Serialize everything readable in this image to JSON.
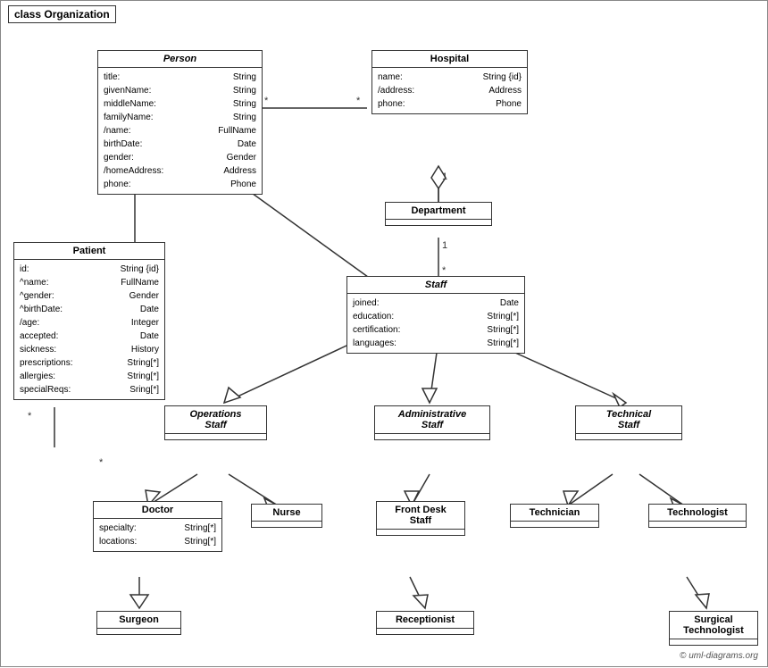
{
  "title": "class Organization",
  "classes": {
    "person": {
      "name": "Person",
      "italic": true,
      "attrs": [
        {
          "name": "title:",
          "type": "String"
        },
        {
          "name": "givenName:",
          "type": "String"
        },
        {
          "name": "middleName:",
          "type": "String"
        },
        {
          "name": "familyName:",
          "type": "String"
        },
        {
          "name": "/name:",
          "type": "FullName"
        },
        {
          "name": "birthDate:",
          "type": "Date"
        },
        {
          "name": "gender:",
          "type": "Gender"
        },
        {
          "name": "/homeAddress:",
          "type": "Address"
        },
        {
          "name": "phone:",
          "type": "Phone"
        }
      ]
    },
    "hospital": {
      "name": "Hospital",
      "italic": false,
      "attrs": [
        {
          "name": "name:",
          "type": "String {id}"
        },
        {
          "name": "/address:",
          "type": "Address"
        },
        {
          "name": "phone:",
          "type": "Phone"
        }
      ]
    },
    "patient": {
      "name": "Patient",
      "italic": false,
      "attrs": [
        {
          "name": "id:",
          "type": "String {id}"
        },
        {
          "name": "^name:",
          "type": "FullName"
        },
        {
          "name": "^gender:",
          "type": "Gender"
        },
        {
          "name": "^birthDate:",
          "type": "Date"
        },
        {
          "name": "/age:",
          "type": "Integer"
        },
        {
          "name": "accepted:",
          "type": "Date"
        },
        {
          "name": "sickness:",
          "type": "History"
        },
        {
          "name": "prescriptions:",
          "type": "String[*]"
        },
        {
          "name": "allergies:",
          "type": "String[*]"
        },
        {
          "name": "specialReqs:",
          "type": "Sring[*]"
        }
      ]
    },
    "department": {
      "name": "Department",
      "italic": false,
      "attrs": []
    },
    "staff": {
      "name": "Staff",
      "italic": true,
      "attrs": [
        {
          "name": "joined:",
          "type": "Date"
        },
        {
          "name": "education:",
          "type": "String[*]"
        },
        {
          "name": "certification:",
          "type": "String[*]"
        },
        {
          "name": "languages:",
          "type": "String[*]"
        }
      ]
    },
    "operations_staff": {
      "name": "Operations\nStaff",
      "italic": true,
      "attrs": []
    },
    "administrative_staff": {
      "name": "Administrative\nStaff",
      "italic": true,
      "attrs": []
    },
    "technical_staff": {
      "name": "Technical\nStaff",
      "italic": true,
      "attrs": []
    },
    "doctor": {
      "name": "Doctor",
      "italic": false,
      "attrs": [
        {
          "name": "specialty:",
          "type": "String[*]"
        },
        {
          "name": "locations:",
          "type": "String[*]"
        }
      ]
    },
    "nurse": {
      "name": "Nurse",
      "italic": false,
      "attrs": []
    },
    "front_desk_staff": {
      "name": "Front Desk\nStaff",
      "italic": false,
      "attrs": []
    },
    "technician": {
      "name": "Technician",
      "italic": false,
      "attrs": []
    },
    "technologist": {
      "name": "Technologist",
      "italic": false,
      "attrs": []
    },
    "surgeon": {
      "name": "Surgeon",
      "italic": false,
      "attrs": []
    },
    "receptionist": {
      "name": "Receptionist",
      "italic": false,
      "attrs": []
    },
    "surgical_technologist": {
      "name": "Surgical\nTechnologist",
      "italic": false,
      "attrs": []
    }
  },
  "copyright": "© uml-diagrams.org"
}
